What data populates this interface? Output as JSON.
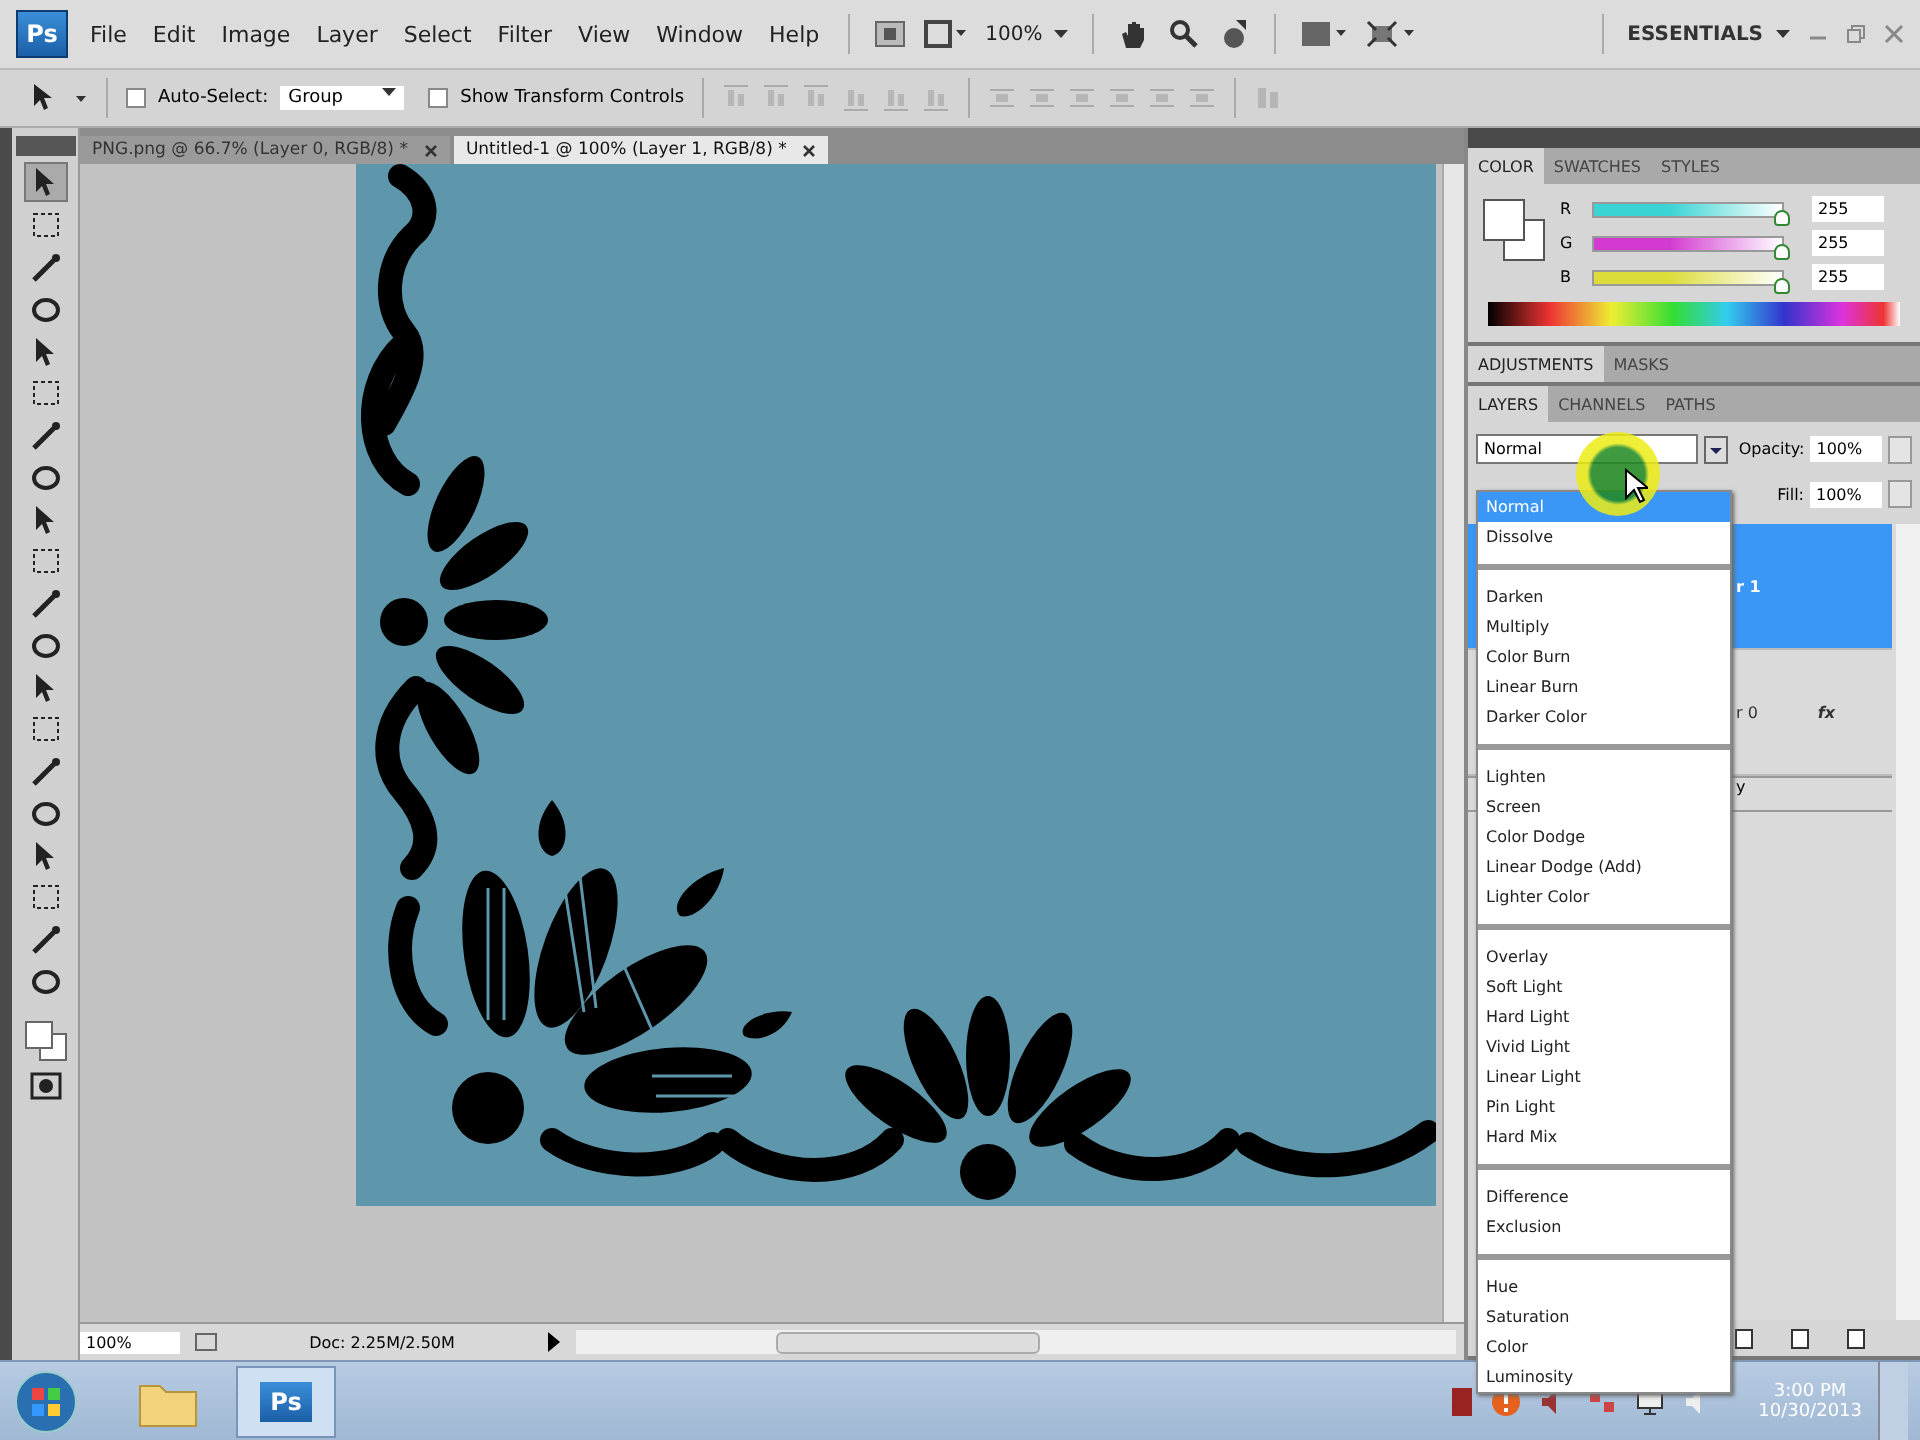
{
  "app": {
    "logo": "Ps",
    "menu": [
      "File",
      "Edit",
      "Image",
      "Layer",
      "Select",
      "Filter",
      "View",
      "Window",
      "Help"
    ],
    "zoom": "100%",
    "workspace": "ESSENTIALS"
  },
  "options_bar": {
    "auto_select": {
      "label": "Auto-Select:",
      "checked": false
    },
    "auto_select_target": "Group",
    "show_transform": {
      "label": "Show Transform Controls",
      "checked": false
    }
  },
  "document_tabs": [
    {
      "label": "PNG.png @ 66.7% (Layer 0, RGB/8) *",
      "selected": false
    },
    {
      "label": "Untitled-1 @ 100% (Layer 1, RGB/8) *",
      "selected": true
    }
  ],
  "color_panel": {
    "tabs": [
      {
        "label": "COLOR",
        "selected": true
      },
      {
        "label": "SWATCHES",
        "selected": false
      },
      {
        "label": "STYLES",
        "selected": false
      }
    ],
    "channels": [
      {
        "name": "R",
        "color": "#3ad4d4",
        "level": 1,
        "value": "255"
      },
      {
        "name": "G",
        "color": "#d23ad2",
        "level": 1,
        "value": "255"
      },
      {
        "name": "B",
        "color": "#dcdc3a",
        "level": 1,
        "value": "255"
      }
    ]
  },
  "adjustments_panel": {
    "tabs": [
      {
        "label": "ADJUSTMENTS",
        "selected": true
      },
      {
        "label": "MASKS",
        "selected": false
      }
    ]
  },
  "layers_panel": {
    "tabs": [
      {
        "label": "LAYERS",
        "selected": true
      },
      {
        "label": "CHANNELS",
        "selected": false
      },
      {
        "label": "PATHS",
        "selected": false
      }
    ],
    "blend_mode": "Normal",
    "opacity_label": "Opacity:",
    "opacity": "100%",
    "fill_label": "Fill:",
    "fill": "100%",
    "layers": [
      {
        "name": "r 1",
        "selected": true
      },
      {
        "name": "r 0",
        "selected": false,
        "effects_label": "fx"
      }
    ],
    "row_fragment": "y"
  },
  "blend_menu": {
    "groups": [
      {
        "items": [
          {
            "label": "Normal",
            "selected": true
          },
          {
            "label": "Dissolve",
            "selected": false
          }
        ]
      },
      {
        "items": [
          {
            "label": "Darken",
            "selected": false
          },
          {
            "label": "Multiply",
            "selected": false
          },
          {
            "label": "Color Burn",
            "selected": false
          },
          {
            "label": "Linear Burn",
            "selected": false
          },
          {
            "label": "Darker Color",
            "selected": false
          }
        ]
      },
      {
        "items": [
          {
            "label": "Lighten",
            "selected": false
          },
          {
            "label": "Screen",
            "selected": false
          },
          {
            "label": "Color Dodge",
            "selected": false
          },
          {
            "label": "Linear Dodge (Add)",
            "selected": false
          },
          {
            "label": "Lighter Color",
            "selected": false
          }
        ]
      },
      {
        "items": [
          {
            "label": "Overlay",
            "selected": false
          },
          {
            "label": "Soft Light",
            "selected": false
          },
          {
            "label": "Hard Light",
            "selected": false
          },
          {
            "label": "Vivid Light",
            "selected": false
          },
          {
            "label": "Linear Light",
            "selected": false
          },
          {
            "label": "Pin Light",
            "selected": false
          },
          {
            "label": "Hard Mix",
            "selected": false
          }
        ]
      },
      {
        "items": [
          {
            "label": "Difference",
            "selected": false
          },
          {
            "label": "Exclusion",
            "selected": false
          }
        ]
      },
      {
        "items": [
          {
            "label": "Hue",
            "selected": false
          },
          {
            "label": "Saturation",
            "selected": false
          },
          {
            "label": "Color",
            "selected": false
          },
          {
            "label": "Luminosity",
            "selected": false
          }
        ]
      }
    ]
  },
  "status_bar": {
    "zoom": "100%",
    "doc": "Doc: 2.25M/2.50M"
  },
  "taskbar": {
    "app_label": "Ps",
    "time": "3:00 PM",
    "date": "10/30/2013"
  }
}
